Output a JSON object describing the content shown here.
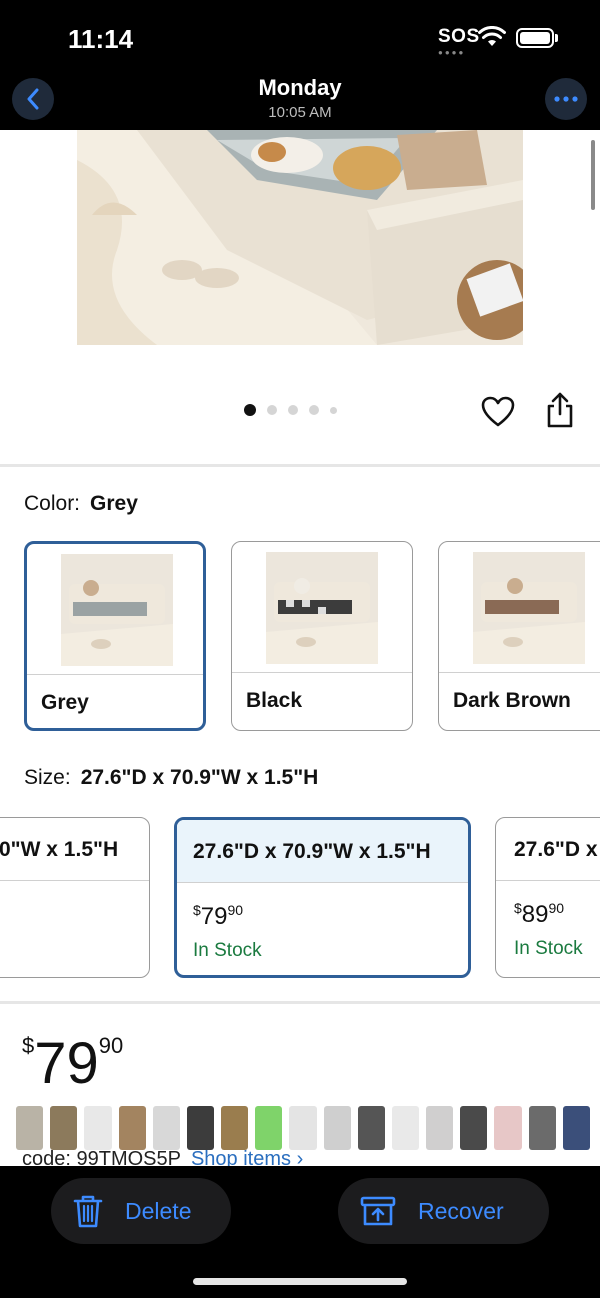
{
  "status_bar": {
    "time": "11:14",
    "carrier": "SOS"
  },
  "nav": {
    "title": "Monday",
    "subtitle": "10:05 AM"
  },
  "product": {
    "image_carousel": {
      "page_count": 5,
      "active_index": 0
    },
    "color": {
      "label": "Color:",
      "selected": "Grey",
      "options": [
        {
          "name": "Grey",
          "selected": true
        },
        {
          "name": "Black",
          "selected": false
        },
        {
          "name": "Dark Brown",
          "selected": false
        }
      ]
    },
    "size": {
      "label": "Size:",
      "selected": "27.6\"D x 70.9\"W x 1.5\"H",
      "options": [
        {
          "dimension": "0\"W x 1.5\"H",
          "price_whole": "",
          "price_cents": "",
          "stock": "",
          "selected": false
        },
        {
          "dimension": "27.6\"D x 70.9\"W x 1.5\"H",
          "price_whole": "79",
          "price_cents": "90",
          "stock": "In Stock",
          "selected": true
        },
        {
          "dimension": "27.6\"D x",
          "price_whole": "89",
          "price_cents": "90",
          "stock": "In Stock",
          "selected": false
        }
      ]
    },
    "price": {
      "currency": "$",
      "whole": "79",
      "cents": "90"
    },
    "code_line": {
      "text": "code: 99TMOS5P",
      "link": "Shop items ›"
    }
  },
  "toolbar": {
    "delete_label": "Delete",
    "recover_label": "Recover"
  },
  "colors": {
    "accent": "#3d8bff",
    "selected_border": "#2f5f98",
    "in_stock": "#1a7a3f",
    "link": "#2a6ebf"
  }
}
